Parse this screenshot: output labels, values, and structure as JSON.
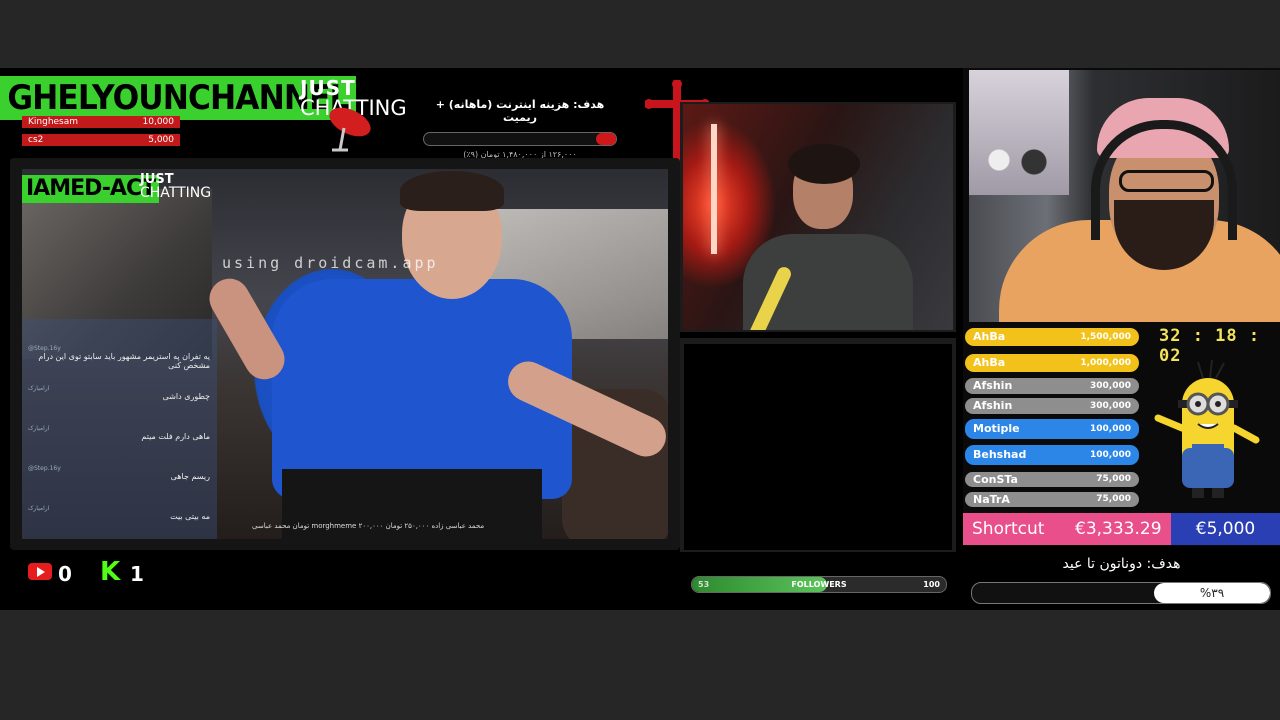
{
  "header": {
    "channel_name": "GHELYOUNCHANNEL",
    "category_line1": "JUST",
    "category_line2": "CHATTING"
  },
  "top_donors": [
    {
      "name": "Kinghesam",
      "amount": "10,000"
    },
    {
      "name": "cs2",
      "amount": "5,000"
    }
  ],
  "internet_goal": {
    "title": "هدف: هزینه اینترنت (ماهانه) + ریمیت",
    "progress_text": "۱۲۶,۰۰۰ از ۱,۴۸۰,۰۰۰ تومان (۹٪)",
    "progress": 0.09
  },
  "main_video": {
    "inner_channel": "IAMED-ACT",
    "inner_line1": "JUST",
    "inner_line2": "CHATTING",
    "watermark": "using droidcam.app",
    "chat": [
      {
        "user": "@Step.16y",
        "text": "یه تفران په استریمر مشهور باید سابتو توی این درام مشخص کنی"
      },
      {
        "user": "ارامیارک",
        "text": "چطوری داشی"
      },
      {
        "user": "ارامیارک",
        "text": "ماهی دارم فلت میتم"
      },
      {
        "user": "@Step.16y",
        "text": "ریسم جاهی"
      },
      {
        "user": "ارامیارک",
        "text": "مه بیتی بیت"
      }
    ],
    "caption": "محمد عباسی زاده ۲۵۰,۰۰۰ تومان   morghmeme   ۲۰۰,۰۰۰ تومان   محمد عباسی"
  },
  "stats": {
    "youtube_count": "0",
    "kick_icon": "K",
    "kick_count": "1"
  },
  "followers": {
    "label": "FOLLOWERS",
    "current": "53",
    "target": "100",
    "progress": 0.53
  },
  "subs": [
    {
      "name": "AhBa",
      "amount": "1,500,000",
      "color": "#f2c21b"
    },
    {
      "name": "AhBa",
      "amount": "1,000,000",
      "color": "#f2c21b"
    },
    {
      "name": "Afshin",
      "amount": "300,000",
      "color": "#8e8e8e"
    },
    {
      "name": "Afshin",
      "amount": "300,000",
      "color": "#8e8e8e"
    },
    {
      "name": "Motiple",
      "amount": "100,000",
      "color": "#2b86e8"
    },
    {
      "name": "Behshad",
      "amount": "100,000",
      "color": "#2b86e8"
    },
    {
      "name": "ConSTa",
      "amount": "75,000",
      "color": "#8e8e8e"
    },
    {
      "name": "NaTrA",
      "amount": "75,000",
      "color": "#8e8e8e"
    }
  ],
  "timer": "32 : 18 : 02",
  "shortcut": {
    "name": "Shortcut",
    "current": "€3,333.29",
    "goal": "€5,000"
  },
  "donathon_goal": {
    "title": "هدف: دوناتون تا عید",
    "percent": "%۳۹",
    "progress": 0.39
  }
}
